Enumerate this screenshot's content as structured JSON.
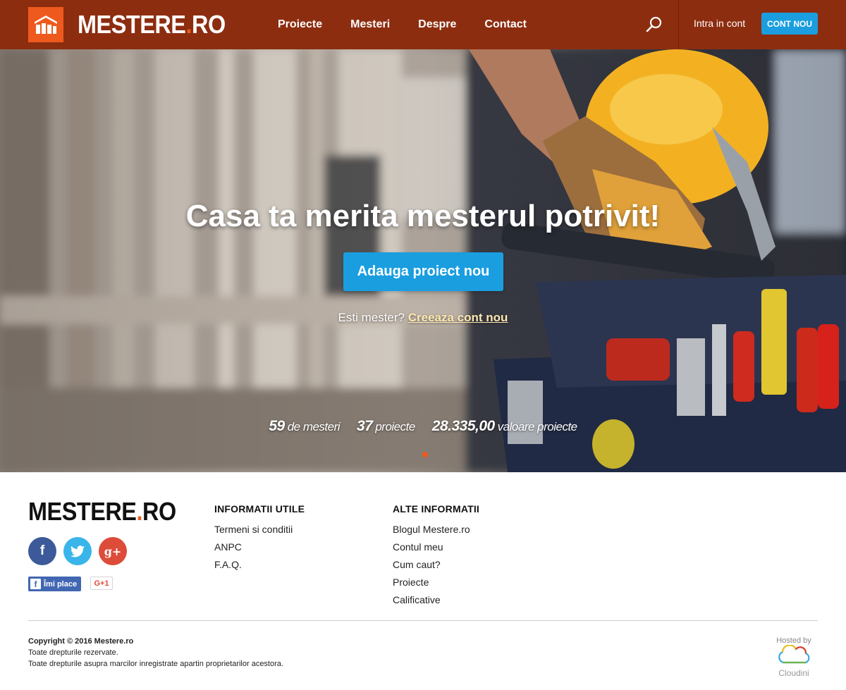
{
  "header": {
    "logo_text": "MESTERE",
    "logo_dot": ".",
    "logo_suffix": "RO",
    "nav": [
      "Proiecte",
      "Mesteri",
      "Despre",
      "Contact"
    ],
    "login": "Intra in cont",
    "signup": "CONT NOU"
  },
  "hero": {
    "title": "Casa ta merita mesterul potrivit!",
    "cta": "Adauga proiect nou",
    "sub_text": "Esti mester?",
    "sub_link": "Creeaza cont nou",
    "stats": [
      {
        "value": "59",
        "label": "de mesteri"
      },
      {
        "value": "37",
        "label": "proiecte"
      },
      {
        "value": "28.335,00",
        "label": "valoare proiecte"
      }
    ]
  },
  "footer": {
    "logo_text": "MESTERE",
    "logo_dot": ".",
    "logo_suffix": "RO",
    "social": {
      "facebook": "f",
      "twitter": "twitter-icon",
      "gplus": "g+"
    },
    "like_label": "Îmi place",
    "gplus_label": "G+1",
    "col1": {
      "title": "INFORMATII UTILE",
      "links": [
        "Termeni si conditii",
        "ANPC",
        "F.A.Q."
      ]
    },
    "col2": {
      "title": "ALTE INFORMATII",
      "links": [
        "Blogul Mestere.ro",
        "Contul meu",
        "Cum caut?",
        "Proiecte",
        "Calificative"
      ]
    },
    "copyright": "Copyright © 2016 Mestere.ro",
    "rights": "Toate drepturile rezervate.",
    "rights2": "Toate drepturile asupra marcilor inregistrate apartin proprietarilor acestora.",
    "hosted_by": "Hosted by",
    "host_name": "Cloudini"
  },
  "colors": {
    "header": "#8d2d10",
    "accent": "#ee5a1d",
    "button": "#1a9ee0"
  }
}
